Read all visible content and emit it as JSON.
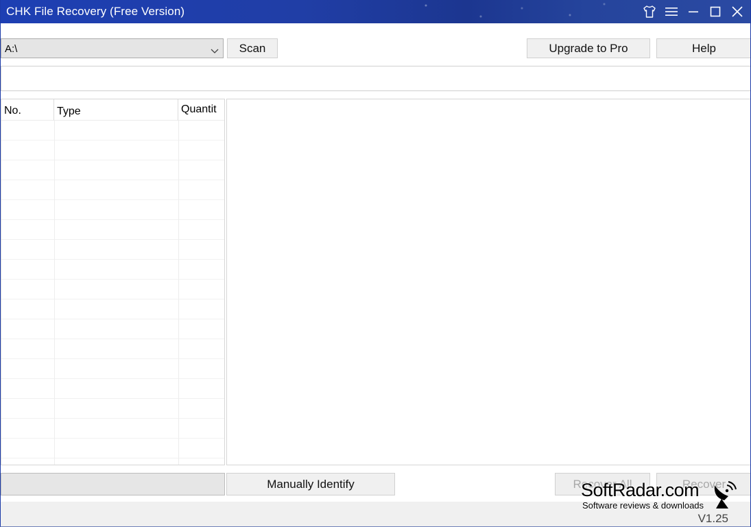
{
  "window": {
    "title": "CHK File Recovery (Free Version)",
    "titlebar_icons": [
      "skin-icon",
      "menu-icon",
      "minimize-icon",
      "maximize-icon",
      "close-icon"
    ]
  },
  "toolbar": {
    "drive_value": "A:\\",
    "scan_label": "Scan",
    "upgrade_label": "Upgrade to Pro",
    "help_label": "Help"
  },
  "path_field": {
    "value": ""
  },
  "type_table": {
    "columns": [
      "No.",
      "Type",
      "Quantit"
    ],
    "rows": []
  },
  "actions": {
    "manual_label": "Manually Identify",
    "recover_all_label": "Recover All",
    "recover_label": "Recover"
  },
  "status": {
    "version": "V1.25"
  },
  "watermark": {
    "brand": "SoftRadar.com",
    "tagline": "Software reviews & downloads"
  },
  "colors": {
    "titlebar": "#1d3fb3",
    "disabled_text": "#a8a8a8"
  }
}
